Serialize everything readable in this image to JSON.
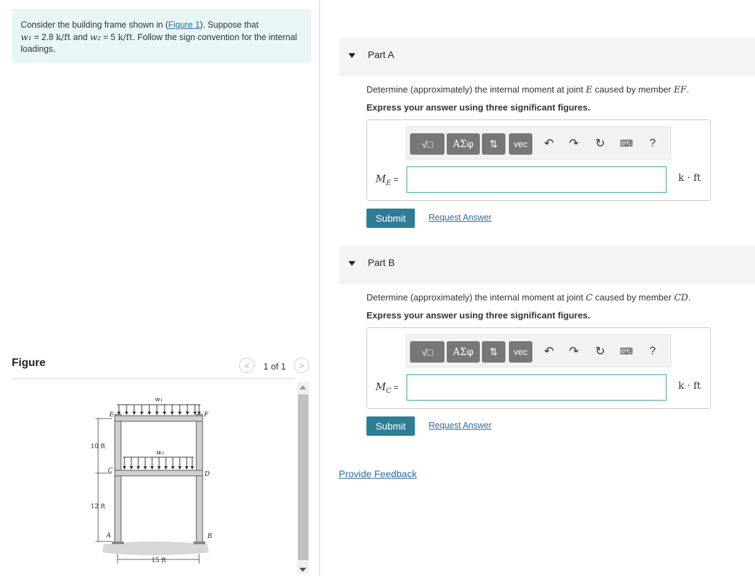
{
  "problem": {
    "text_pre": "Consider the building frame shown in (",
    "figure_link": "Figure 1",
    "text_mid": "). Suppose that",
    "w1_sym": "w₁",
    "w1_eq": " = 2.8 ",
    "w1_unit": "k/ft",
    "and": " and ",
    "w2_sym": "w₂",
    "w2_eq": " = 5 ",
    "w2_unit": "k/ft",
    "text_post": ". Follow the sign convention for the internal loadings."
  },
  "figure": {
    "title": "Figure",
    "pager": "1 of 1",
    "labels": {
      "w1": "w₁",
      "w2": "w₂",
      "E": "E",
      "F": "F",
      "C": "C",
      "D": "D",
      "A": "A",
      "B": "B",
      "h1": "10 ft",
      "h2": "12 ft",
      "span": "15 ft"
    }
  },
  "toolbar": {
    "templates_icon": "√□",
    "greek": "ΑΣφ",
    "arrows": "⇅",
    "vec": "vec",
    "help": "?"
  },
  "partA": {
    "header": "Part A",
    "q_pre": "Determine (approximately) the internal moment at joint ",
    "q_joint": "E",
    "q_mid": " caused by member ",
    "q_member": "EF",
    "q_post": ".",
    "instruction": "Express your answer using three significant figures.",
    "var_sym": "M",
    "var_sub": "E",
    "var_eq": " =",
    "input_value": "",
    "unit": "k · ft",
    "submit": "Submit",
    "request": "Request Answer"
  },
  "partB": {
    "header": "Part B",
    "q_pre": "Determine (approximately) the internal moment at joint ",
    "q_joint": "C",
    "q_mid": " caused by member ",
    "q_member": "CD",
    "q_post": ".",
    "instruction": "Express your answer using three significant figures.",
    "var_sym": "M",
    "var_sub": "C",
    "var_eq": " =",
    "input_value": "",
    "unit": "k · ft",
    "submit": "Submit",
    "request": "Request Answer"
  },
  "feedback": "Provide Feedback"
}
